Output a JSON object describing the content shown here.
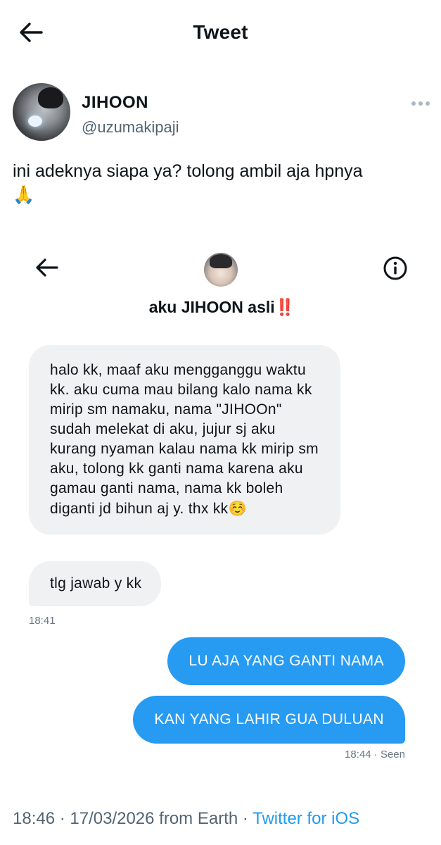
{
  "header": {
    "title": "Tweet"
  },
  "author": {
    "name": "JIHOON",
    "handle": "@uzumakipaji"
  },
  "tweet": {
    "text": "ini adeknya siapa ya? tolong ambil aja hpnya",
    "emoji": "🙏"
  },
  "screenshot": {
    "conversation_name": "aku JIHOON asli",
    "conversation_badge": "‼️",
    "messages_in": [
      {
        "text": "halo kk, maaf aku mengganggu waktu kk. aku cuma mau bilang kalo nama kk mirip sm namaku, nama \"JIHOOn\" sudah melekat di aku, jujur sj aku kurang nyaman kalau nama kk mirip sm aku, tolong kk ganti nama karena aku gamau ganti nama, nama kk boleh diganti jd bihun aj y. thx kk",
        "emoji": "☺️"
      },
      {
        "text": "tlg jawab y kk"
      }
    ],
    "time_in": "18:41",
    "messages_out": [
      {
        "text": "LU AJA YANG GANTI NAMA"
      },
      {
        "text": "KAN YANG LAHIR GUA DULUAN"
      }
    ],
    "time_out": "18:44 · Seen"
  },
  "footer": {
    "meta": "18:46 · 17/03/2026 from Earth · ",
    "source": "Twitter for iOS"
  },
  "colors": {
    "accent": "#1d9bf0",
    "bubble_out": "#279bf2",
    "bubble_in": "#eff1f3",
    "alert": "#e0182d"
  },
  "icons": [
    "arrow-left-icon",
    "more-horizontal-icon",
    "info-icon"
  ]
}
